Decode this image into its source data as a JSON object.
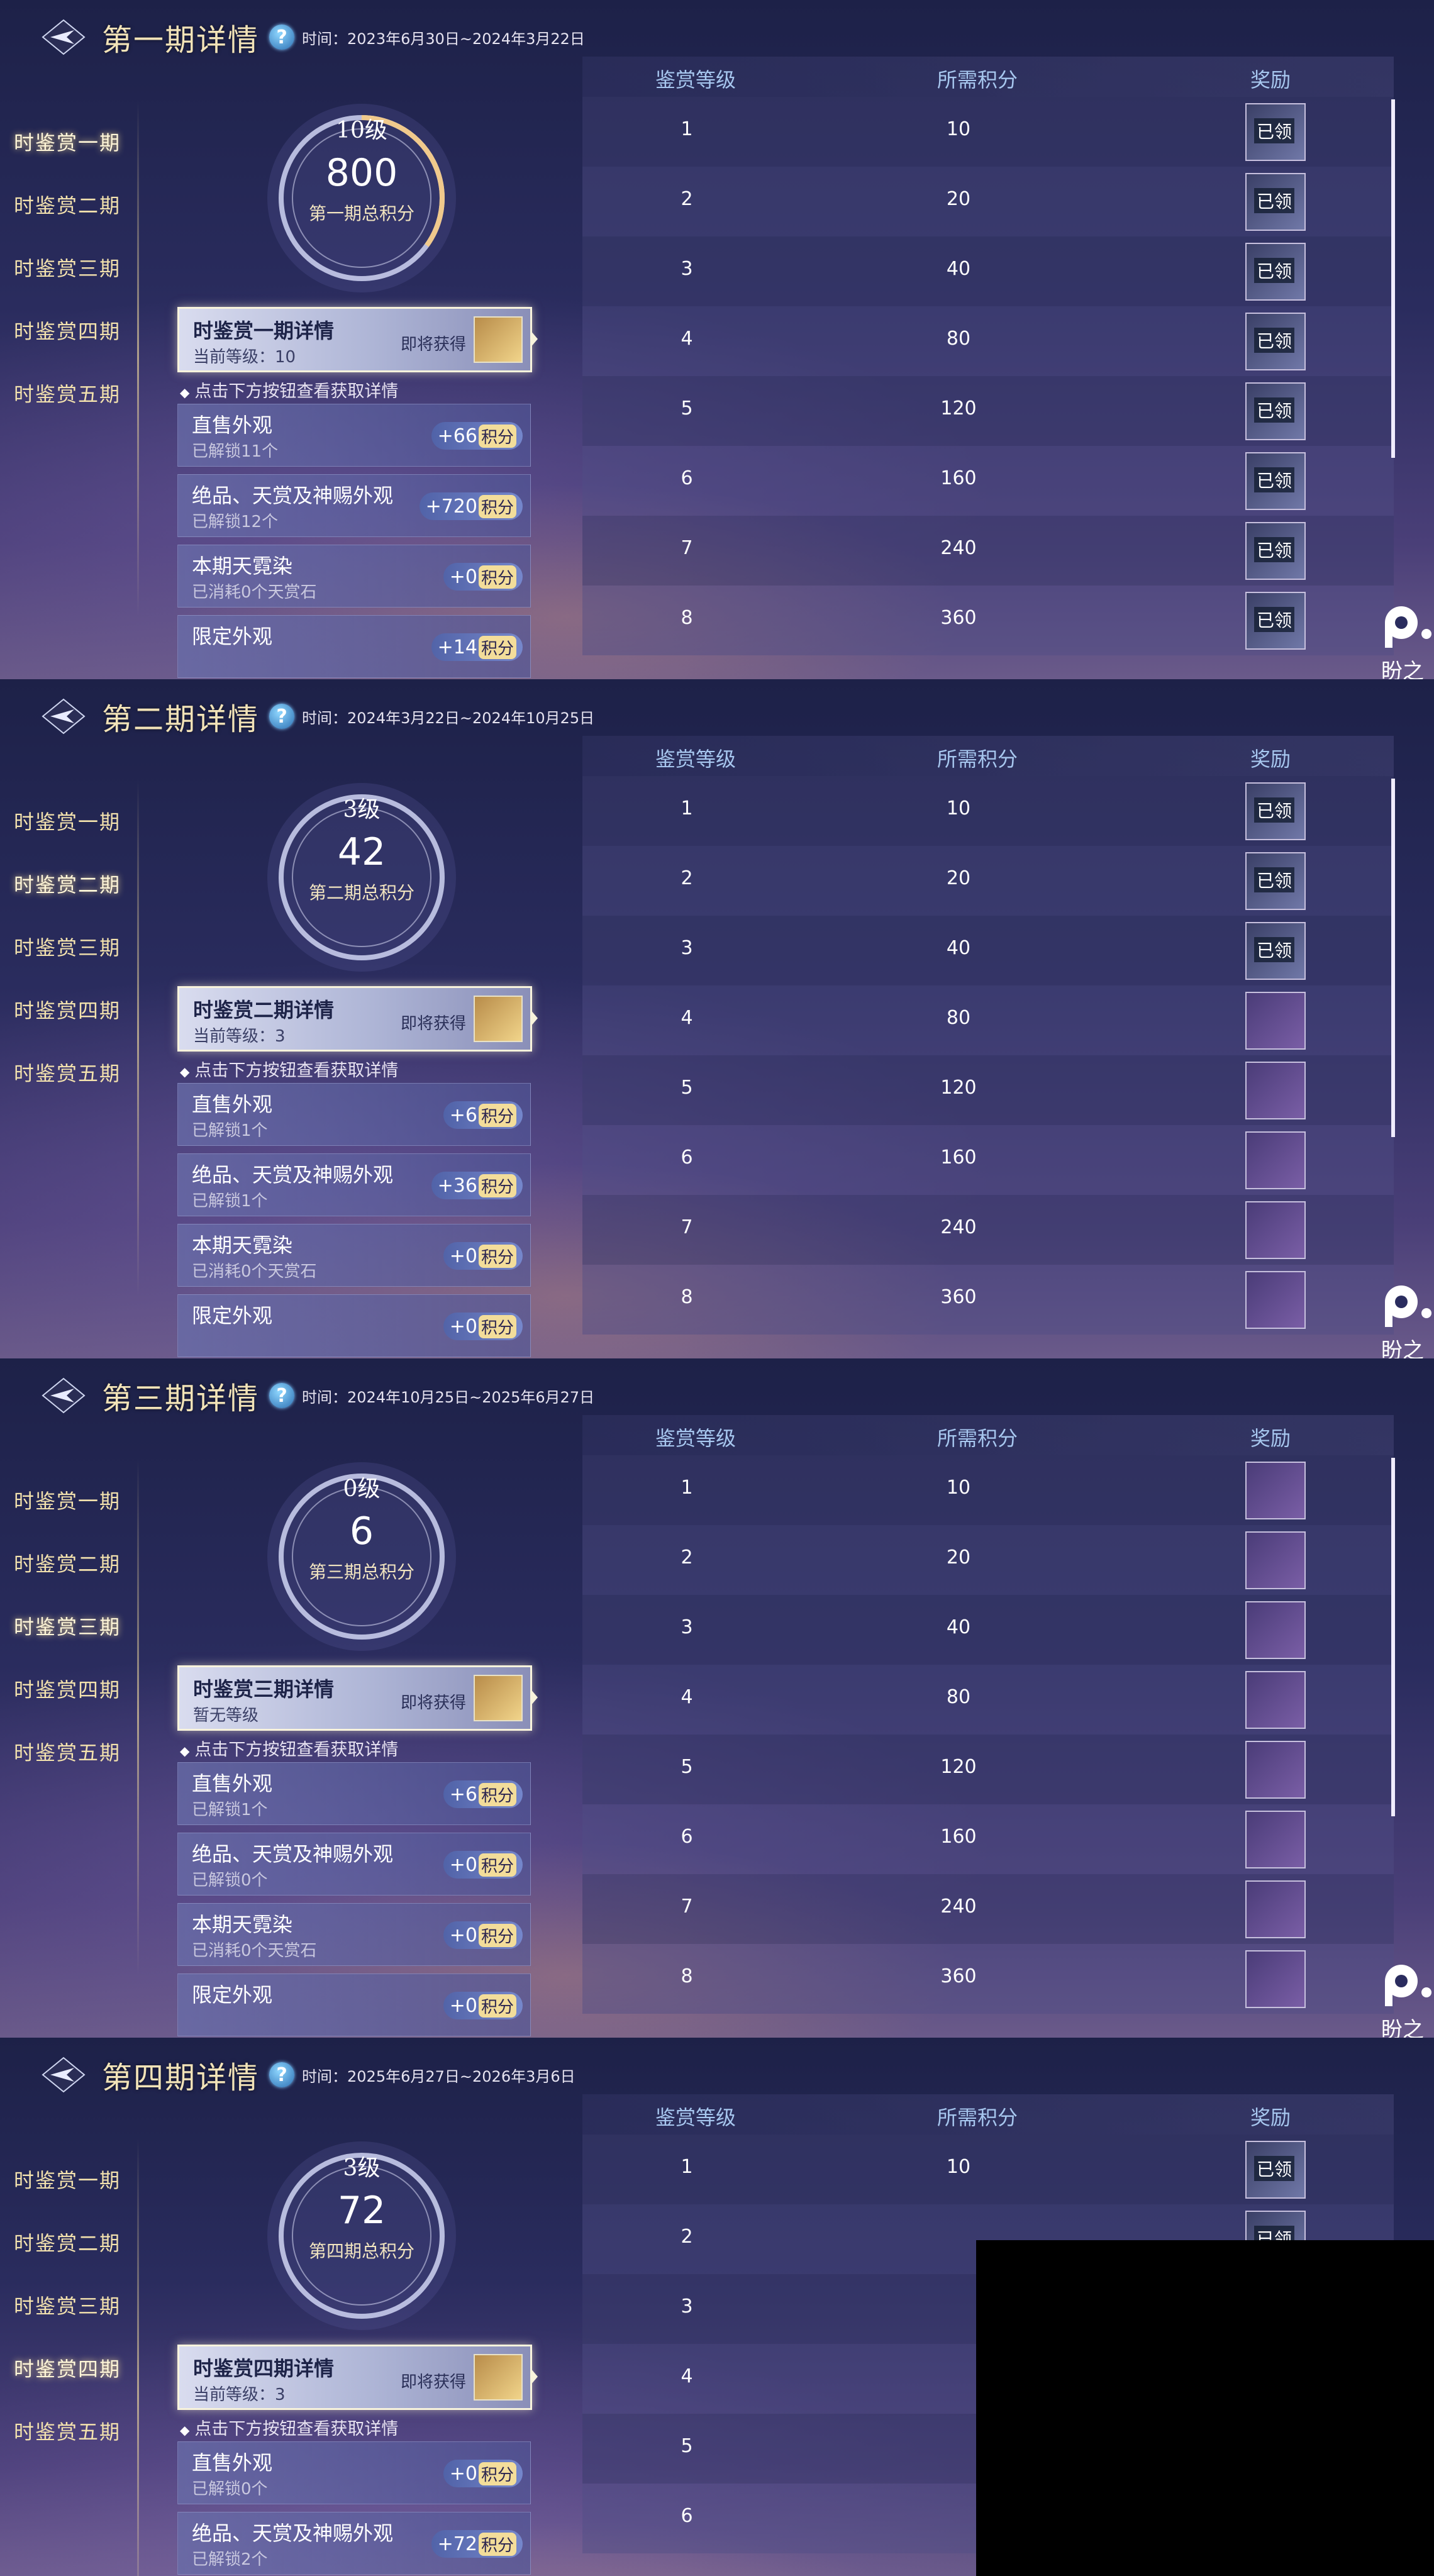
{
  "nav_items": [
    "时鉴赏一期",
    "时鉴赏二期",
    "时鉴赏三期",
    "时鉴赏四期",
    "时鉴赏五期"
  ],
  "table_headers": {
    "level": "鉴赏等级",
    "points": "所需积分",
    "reward": "奖励"
  },
  "claimed_label": "已领",
  "hint": "点击下方按钮查看获取详情",
  "soon_label": "即将获得",
  "badge_unit": "积分",
  "watermark_text": "盼之",
  "colors": {
    "title": "#f2e3b8",
    "header_text": "#a7c7ef",
    "nav_text": "#f3e2ae",
    "badge_unit_bg": "#f3dd9a"
  },
  "panels": [
    {
      "title": "第一期详情",
      "time": "时间：2023年6月30日~2024年3月22日",
      "active_nav": 0,
      "circle": {
        "level": "10级",
        "score": "800",
        "caption": "第一期总积分",
        "progress": 0.35
      },
      "detail": {
        "title": "时鉴赏一期详情",
        "sub": "当前等级：10"
      },
      "rows": [
        {
          "title": "直售外观",
          "sub": "已解锁11个",
          "badge": "+66"
        },
        {
          "title": "绝品、天赏及神赐外观",
          "sub": "已解锁12个",
          "badge": "+720"
        },
        {
          "title": "本期天霓染",
          "sub": "已消耗0个天赏石",
          "badge": "+0"
        },
        {
          "title": "限定外观",
          "sub": "",
          "badge": "+14"
        }
      ],
      "table": [
        {
          "level": "1",
          "points": "10",
          "claimed": true
        },
        {
          "level": "2",
          "points": "20",
          "claimed": true
        },
        {
          "level": "3",
          "points": "40",
          "claimed": true
        },
        {
          "level": "4",
          "points": "80",
          "claimed": true
        },
        {
          "level": "5",
          "points": "120",
          "claimed": true
        },
        {
          "level": "6",
          "points": "160",
          "claimed": true
        },
        {
          "level": "7",
          "points": "240",
          "claimed": true
        },
        {
          "level": "8",
          "points": "360",
          "claimed": true
        }
      ]
    },
    {
      "title": "第二期详情",
      "time": "时间：2024年3月22日~2024年10月25日",
      "active_nav": 1,
      "circle": {
        "level": "3级",
        "score": "42",
        "caption": "第二期总积分",
        "progress": 0
      },
      "detail": {
        "title": "时鉴赏二期详情",
        "sub": "当前等级：3"
      },
      "rows": [
        {
          "title": "直售外观",
          "sub": "已解锁1个",
          "badge": "+6"
        },
        {
          "title": "绝品、天赏及神赐外观",
          "sub": "已解锁1个",
          "badge": "+36"
        },
        {
          "title": "本期天霓染",
          "sub": "已消耗0个天赏石",
          "badge": "+0"
        },
        {
          "title": "限定外观",
          "sub": "",
          "badge": "+0"
        }
      ],
      "table": [
        {
          "level": "1",
          "points": "10",
          "claimed": true
        },
        {
          "level": "2",
          "points": "20",
          "claimed": true
        },
        {
          "level": "3",
          "points": "40",
          "claimed": true
        },
        {
          "level": "4",
          "points": "80",
          "claimed": false
        },
        {
          "level": "5",
          "points": "120",
          "claimed": false
        },
        {
          "level": "6",
          "points": "160",
          "claimed": false
        },
        {
          "level": "7",
          "points": "240",
          "claimed": false
        },
        {
          "level": "8",
          "points": "360",
          "claimed": false
        }
      ]
    },
    {
      "title": "第三期详情",
      "time": "时间：2024年10月25日~2025年6月27日",
      "active_nav": 2,
      "circle": {
        "level": "0级",
        "score": "6",
        "caption": "第三期总积分",
        "progress": 0
      },
      "detail": {
        "title": "时鉴赏三期详情",
        "sub": "暂无等级"
      },
      "rows": [
        {
          "title": "直售外观",
          "sub": "已解锁1个",
          "badge": "+6"
        },
        {
          "title": "绝品、天赏及神赐外观",
          "sub": "已解锁0个",
          "badge": "+0"
        },
        {
          "title": "本期天霓染",
          "sub": "已消耗0个天赏石",
          "badge": "+0"
        },
        {
          "title": "限定外观",
          "sub": "",
          "badge": "+0"
        }
      ],
      "table": [
        {
          "level": "1",
          "points": "10",
          "claimed": false
        },
        {
          "level": "2",
          "points": "20",
          "claimed": false
        },
        {
          "level": "3",
          "points": "40",
          "claimed": false
        },
        {
          "level": "4",
          "points": "80",
          "claimed": false
        },
        {
          "level": "5",
          "points": "120",
          "claimed": false
        },
        {
          "level": "6",
          "points": "160",
          "claimed": false
        },
        {
          "level": "7",
          "points": "240",
          "claimed": false
        },
        {
          "level": "8",
          "points": "360",
          "claimed": false
        }
      ]
    },
    {
      "title": "第四期详情",
      "time": "时间：2025年6月27日~2026年3月6日",
      "active_nav": 3,
      "circle": {
        "level": "3级",
        "score": "72",
        "caption": "第四期总积分",
        "progress": 0
      },
      "detail": {
        "title": "时鉴赏四期详情",
        "sub": "当前等级：3"
      },
      "rows": [
        {
          "title": "直售外观",
          "sub": "已解锁0个",
          "badge": "+0"
        },
        {
          "title": "绝品、天赏及神赐外观",
          "sub": "已解锁2个",
          "badge": "+72"
        }
      ],
      "table": [
        {
          "level": "1",
          "points": "10",
          "claimed": true
        },
        {
          "level": "2",
          "points": "",
          "claimed": true
        },
        {
          "level": "3",
          "points": "",
          "claimed": false
        },
        {
          "level": "4",
          "points": "",
          "claimed": false
        },
        {
          "level": "5",
          "points": "",
          "claimed": false
        },
        {
          "level": "6",
          "points": "",
          "claimed": false
        }
      ]
    }
  ]
}
